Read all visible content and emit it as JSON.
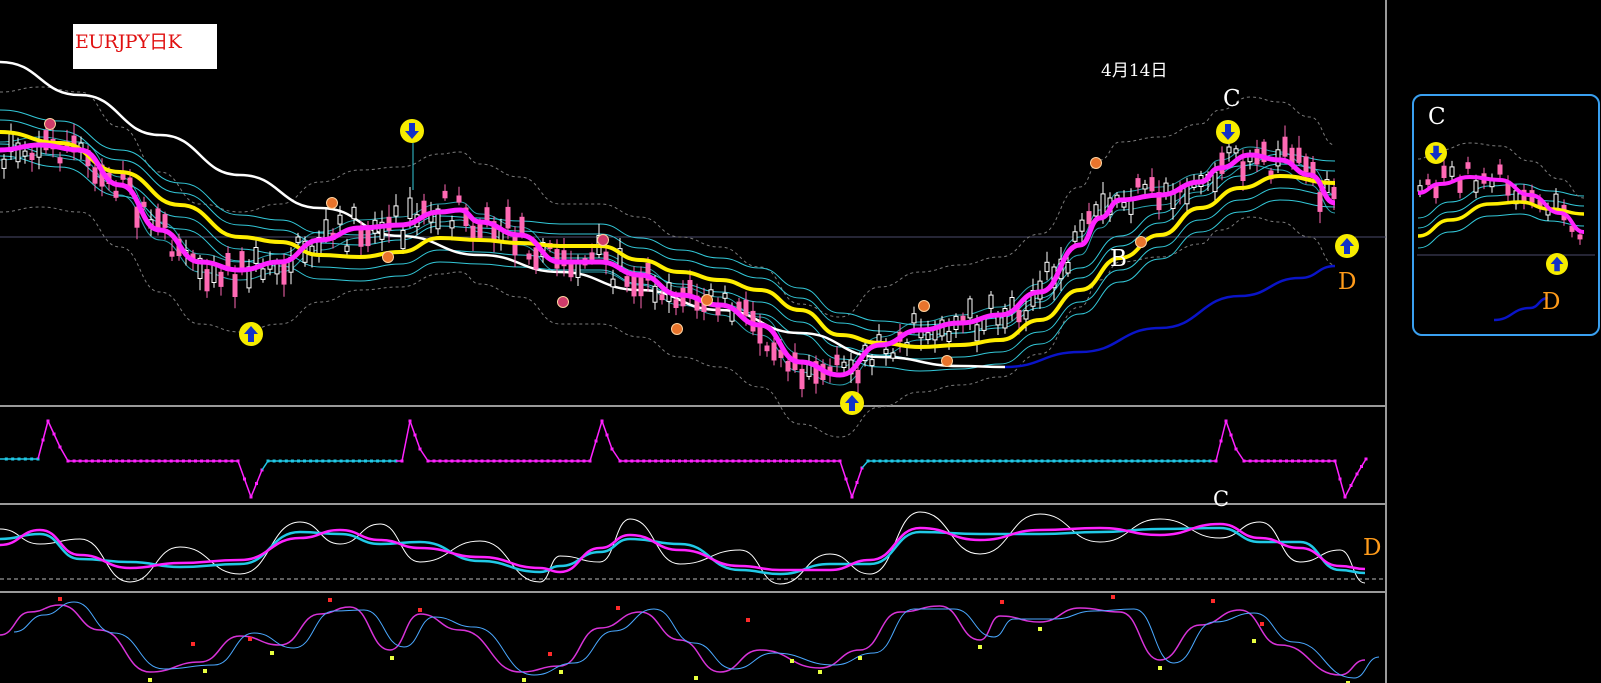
{
  "title": "EURJPY日K",
  "date_label": "4月14日",
  "labels": {
    "c_main": "C",
    "b_main": "B",
    "d_main": "D",
    "c_osc": "C",
    "d_osc": "D",
    "c_inset": "C",
    "d_inset": "D"
  },
  "colors": {
    "background": "#000000",
    "bull": "#ffffff",
    "bear": "#ff69b4",
    "fast_ma": "#ff22ff",
    "mid_ma": "#ffee00",
    "slow_ma": "#ffffff",
    "long_ma": "#0a14c8",
    "band": "#33c8d8",
    "env": "#7a7a7a",
    "arrow_fill": "#f6ec00",
    "arrow_glyph": "#1130c8",
    "marker": "#e8742c",
    "label_orange": "#ff9b1a",
    "ind_cyan": "#21c9e6",
    "ind_magenta": "#ff22ff",
    "inset_border": "#3aa0f0"
  },
  "icons": [
    "buy-arrow-icon",
    "sell-arrow-icon",
    "swing-marker-icon"
  ],
  "chart_data": {
    "type": "candlestick",
    "symbol": "EURJPY",
    "timeframe": "日K",
    "xlabel": "",
    "ylabel": "",
    "grid": false,
    "panels": [
      "price",
      "signal",
      "oscillator",
      "momentum"
    ],
    "notes_on_chart": [
      "4月14日",
      "B",
      "C",
      "D"
    ],
    "fast_ma": [
      [
        0,
        150
      ],
      [
        40,
        145
      ],
      [
        80,
        150
      ],
      [
        120,
        185
      ],
      [
        160,
        230
      ],
      [
        200,
        262
      ],
      [
        240,
        270
      ],
      [
        280,
        262
      ],
      [
        320,
        240
      ],
      [
        360,
        228
      ],
      [
        400,
        225
      ],
      [
        440,
        212
      ],
      [
        460,
        210
      ],
      [
        480,
        222
      ],
      [
        520,
        235
      ],
      [
        560,
        262
      ],
      [
        600,
        262
      ],
      [
        640,
        275
      ],
      [
        680,
        295
      ],
      [
        720,
        305
      ],
      [
        760,
        325
      ],
      [
        800,
        362
      ],
      [
        840,
        375
      ],
      [
        880,
        345
      ],
      [
        920,
        330
      ],
      [
        960,
        323
      ],
      [
        1000,
        315
      ],
      [
        1040,
        292
      ],
      [
        1080,
        245
      ],
      [
        1100,
        218
      ],
      [
        1120,
        200
      ],
      [
        1160,
        195
      ],
      [
        1200,
        182
      ],
      [
        1220,
        168
      ],
      [
        1250,
        155
      ],
      [
        1280,
        160
      ],
      [
        1310,
        175
      ],
      [
        1335,
        203
      ]
    ],
    "mid_ma": [
      [
        0,
        132
      ],
      [
        60,
        143
      ],
      [
        120,
        172
      ],
      [
        180,
        205
      ],
      [
        240,
        237
      ],
      [
        280,
        242
      ],
      [
        320,
        255
      ],
      [
        360,
        257
      ],
      [
        400,
        252
      ],
      [
        440,
        238
      ],
      [
        480,
        240
      ],
      [
        520,
        243
      ],
      [
        560,
        246
      ],
      [
        600,
        246
      ],
      [
        640,
        260
      ],
      [
        680,
        272
      ],
      [
        720,
        280
      ],
      [
        760,
        290
      ],
      [
        800,
        310
      ],
      [
        840,
        335
      ],
      [
        880,
        343
      ],
      [
        920,
        347
      ],
      [
        960,
        345
      ],
      [
        1000,
        340
      ],
      [
        1040,
        320
      ],
      [
        1080,
        290
      ],
      [
        1120,
        258
      ],
      [
        1160,
        235
      ],
      [
        1200,
        208
      ],
      [
        1240,
        188
      ],
      [
        1280,
        176
      ],
      [
        1335,
        183
      ]
    ],
    "slow_ma": [
      [
        0,
        62
      ],
      [
        80,
        95
      ],
      [
        160,
        135
      ],
      [
        240,
        175
      ],
      [
        320,
        208
      ],
      [
        400,
        236
      ],
      [
        480,
        255
      ],
      [
        560,
        272
      ],
      [
        640,
        290
      ],
      [
        720,
        310
      ],
      [
        800,
        333
      ],
      [
        880,
        357
      ],
      [
        960,
        366
      ],
      [
        1005,
        367
      ]
    ],
    "long_ma": [
      [
        1005,
        367
      ],
      [
        1080,
        352
      ],
      [
        1160,
        328
      ],
      [
        1240,
        296
      ],
      [
        1300,
        278
      ],
      [
        1335,
        266
      ]
    ],
    "arrows": [
      {
        "bar": 246,
        "dir": "buy"
      },
      {
        "bar": 403,
        "dir": "sell"
      },
      {
        "bar": 834,
        "dir": "buy"
      },
      {
        "bar": 1201,
        "dir": "sell"
      },
      {
        "bar": 1319,
        "dir": "buy"
      }
    ]
  }
}
